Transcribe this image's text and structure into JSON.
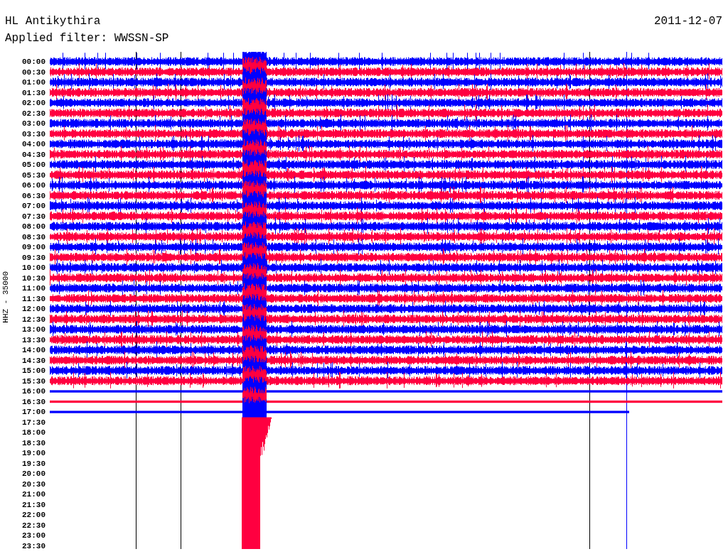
{
  "title": "HL Antikythira",
  "date": "2011-12-07",
  "filter": "Applied filter: WWSSN-SP",
  "axis_label": "HHZ - 35000",
  "rows": [
    {
      "label": "00:00",
      "recorded": true
    },
    {
      "label": "00:30",
      "recorded": true
    },
    {
      "label": "01:00",
      "recorded": true
    },
    {
      "label": "01:30",
      "recorded": true
    },
    {
      "label": "02:00",
      "recorded": true
    },
    {
      "label": "02:30",
      "recorded": true
    },
    {
      "label": "03:00",
      "recorded": true
    },
    {
      "label": "03:30",
      "recorded": true
    },
    {
      "label": "04:00",
      "recorded": true
    },
    {
      "label": "04:30",
      "recorded": true
    },
    {
      "label": "05:00",
      "recorded": true
    },
    {
      "label": "05:30",
      "recorded": true
    },
    {
      "label": "06:00",
      "recorded": true
    },
    {
      "label": "06:30",
      "recorded": true
    },
    {
      "label": "07:00",
      "recorded": true
    },
    {
      "label": "07:30",
      "recorded": true
    },
    {
      "label": "08:00",
      "recorded": true
    },
    {
      "label": "08:30",
      "recorded": true
    },
    {
      "label": "09:00",
      "recorded": true
    },
    {
      "label": "09:30",
      "recorded": true
    },
    {
      "label": "10:00",
      "recorded": true
    },
    {
      "label": "10:30",
      "recorded": true
    },
    {
      "label": "11:00",
      "recorded": true
    },
    {
      "label": "11:30",
      "recorded": true
    },
    {
      "label": "12:00",
      "recorded": true
    },
    {
      "label": "12:30",
      "recorded": true
    },
    {
      "label": "13:00",
      "recorded": true
    },
    {
      "label": "13:30",
      "recorded": true
    },
    {
      "label": "14:00",
      "recorded": true
    },
    {
      "label": "14:30",
      "recorded": true
    },
    {
      "label": "15:00",
      "recorded": true
    },
    {
      "label": "15:30",
      "recorded": true
    },
    {
      "label": "16:00",
      "recorded": true
    },
    {
      "label": "16:30",
      "recorded": true
    },
    {
      "label": "17:00",
      "recorded": true
    },
    {
      "label": "17:30",
      "recorded": false
    },
    {
      "label": "18:00",
      "recorded": false
    },
    {
      "label": "18:30",
      "recorded": false
    },
    {
      "label": "19:00",
      "recorded": false
    },
    {
      "label": "19:30",
      "recorded": false
    },
    {
      "label": "20:00",
      "recorded": false
    },
    {
      "label": "20:30",
      "recorded": false
    },
    {
      "label": "21:00",
      "recorded": false
    },
    {
      "label": "21:30",
      "recorded": false
    },
    {
      "label": "22:00",
      "recorded": false
    },
    {
      "label": "22:30",
      "recorded": false
    },
    {
      "label": "23:00",
      "recorded": false
    },
    {
      "label": "23:30",
      "recorded": false
    }
  ]
}
